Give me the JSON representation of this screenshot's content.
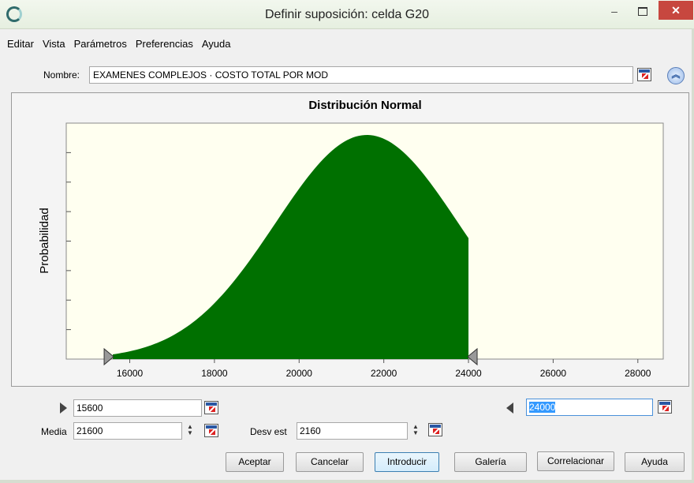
{
  "window": {
    "title": "Definir suposición: celda G20",
    "minimize": "–",
    "close": "✕"
  },
  "menu": [
    "Editar",
    "Vista",
    "Parámetros",
    "Preferencias",
    "Ayuda"
  ],
  "name_row": {
    "label": "Nombre:",
    "value": "EXAMENES COMPLEJOS · COSTO TOTAL POR MOD"
  },
  "chart_data": {
    "type": "area",
    "title": "Distribución Normal",
    "ylabel": "Probabilidad",
    "xlabel": "",
    "distribution": {
      "mean": 21600,
      "stdev": 2160
    },
    "xlim": [
      14500,
      28600
    ],
    "x_ticks": [
      16000,
      18000,
      20000,
      22000,
      24000,
      26000,
      28000
    ],
    "x_tick_labels": [
      "16000",
      "18000",
      "20000",
      "22000",
      "24000",
      "26000",
      "28000"
    ],
    "y_tick_count": 7,
    "shaded_range": [
      15600,
      24000
    ],
    "fill_color": "#007000",
    "plot_background": "#fffff0"
  },
  "lower_bound": {
    "value": "15600"
  },
  "upper_bound": {
    "value": "24000"
  },
  "params": {
    "mean_label": "Media",
    "mean_value": "21600",
    "stdev_label": "Desv est",
    "stdev_value": "2160"
  },
  "buttons": {
    "accept": "Aceptar",
    "cancel": "Cancelar",
    "enter": "Introducir",
    "gallery": "Galería",
    "correlate": "Correlacionar",
    "help": "Ayuda"
  },
  "icons": {
    "collapse": "double-chevron-up-icon",
    "cell_ref": "cell-reference-icon"
  }
}
